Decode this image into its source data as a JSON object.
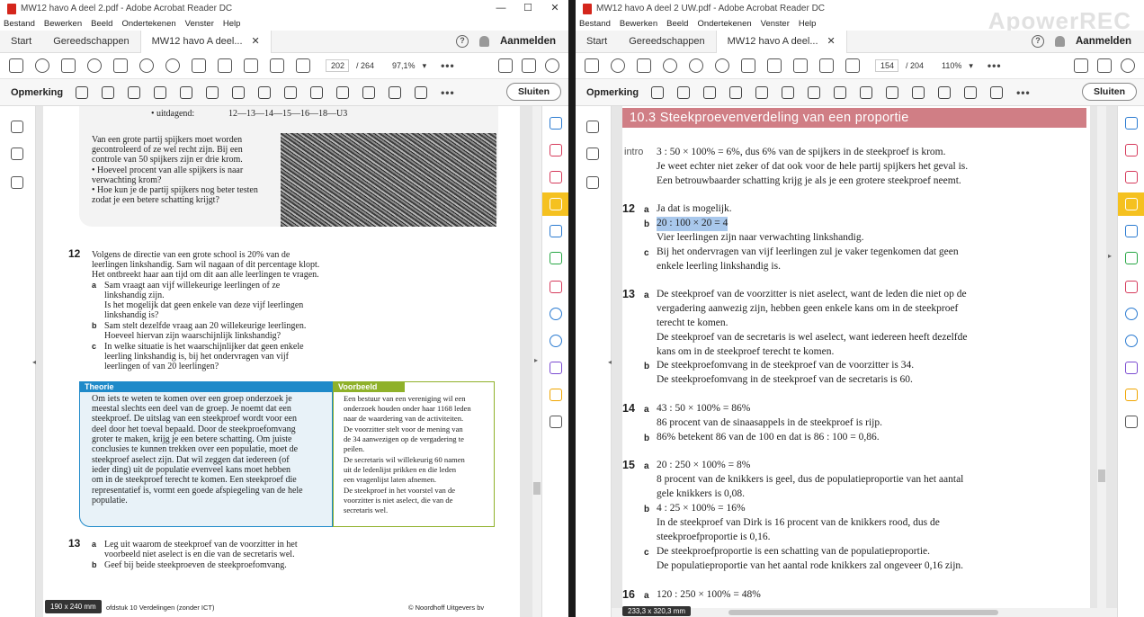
{
  "left": {
    "title": "MW12 havo A deel 2.pdf - Adobe Acrobat Reader DC",
    "menu": [
      "Bestand",
      "Bewerken",
      "Beeld",
      "Ondertekenen",
      "Venster",
      "Help"
    ],
    "tabs": {
      "start": "Start",
      "tools": "Gereedschappen",
      "doc": "MW12 havo A deel..."
    },
    "signin": "Aanmelden",
    "page_current": "202",
    "page_total": "/ 264",
    "zoom": "97,1%",
    "comment_label": "Opmerking",
    "close_label": "Sluiten",
    "size_badge": "190 x 240 mm",
    "content": {
      "uitdagend_label": "• uitdagend:",
      "uitdagend_values": "12—13—14—15—16—18—U3",
      "intro_lines": [
        "Van een grote partij spijkers moet worden",
        "gecontroleerd of ze wel recht zijn. Bij een",
        "controle van 50 spijkers zijn er drie krom.",
        "• Hoeveel procent van alle spijkers is naar",
        "   verwachting krom?",
        "• Hoe kun je de partij spijkers nog beter testen",
        "   zodat je een betere schatting krijgt?"
      ],
      "q12_num": "12",
      "q12_lines": [
        "Volgens de directie van een grote school is 20% van de",
        "leerlingen linkshandig. Sam wil nagaan of dit percentage klopt.",
        "Het ontbreekt haar aan tijd om dit aan alle leerlingen te vragen."
      ],
      "q12a_lines": [
        "Sam vraagt aan vijf willekeurige leerlingen of ze",
        "linkshandig zijn.",
        "Is het mogelijk dat geen enkele van deze vijf leerlingen",
        "linkshandig is?"
      ],
      "q12b_lines": [
        "Sam stelt dezelfde vraag aan 20 willekeurige leerlingen.",
        "Hoeveel hiervan zijn waarschijnlijk linkshandig?"
      ],
      "q12c_lines": [
        "In welke situatie is het waarschijnlijker dat geen enkele",
        "leerling linkshandig is, bij het ondervragen van vijf",
        "leerlingen of van 20 leerlingen?"
      ],
      "theory_head": "Theorie",
      "theory_lines": [
        "Om iets te weten te komen over een groep onderzoek je",
        "meestal slechts een deel van de groep. Je noemt dat een",
        "steekproef. De uitslag van een steekproef wordt voor een",
        "deel door het toeval bepaald. Door de steekproefomvang",
        "groter te maken, krijg je een betere schatting. Om juiste",
        "conclusies te kunnen trekken over een populatie, moet de",
        "steekproef aselect zijn. Dat wil zeggen dat iedereen (of",
        "ieder ding) uit de populatie evenveel kans moet hebben",
        "om in de steekproef terecht te komen. Een steekproef die",
        "representatief is, vormt een goede afspiegeling van de hele",
        "populatie."
      ],
      "example_head": "Voorbeeld",
      "example_lines": [
        "Een bestuur van een vereniging wil een",
        "onderzoek houden onder haar 1168 leden",
        "naar de waardering van de activiteiten.",
        "De voorzitter stelt voor de mening van",
        "de 34 aanwezigen op de vergadering te",
        "peilen.",
        "De secretaris wil willekeurig 60 namen",
        "uit de ledenlijst prikken en die leden",
        "een vragenlijst laten afnemen.",
        "De steekproef in het voorstel van de",
        "voorzitter is niet aselect, die van de",
        "secretaris wel."
      ],
      "q13_num": "13",
      "q13a": "Leg uit waarom de steekproef van de voorzitter in het",
      "q13a2": "voorbeeld niet aselect is en die van de secretaris wel.",
      "q13b": "Geef bij beide steekproeven de steekproefomvang.",
      "footer_left": "ofdstuk 10 Verdelingen (zonder ICT)",
      "footer_right": "© Noordhoff Uitgevers bv"
    }
  },
  "right": {
    "title": "MW12 havo A deel 2 UW.pdf - Adobe Acrobat Reader DC",
    "menu": [
      "Bestand",
      "Bewerken",
      "Beeld",
      "Ondertekenen",
      "Venster",
      "Help"
    ],
    "tabs": {
      "start": "Start",
      "tools": "Gereedschappen",
      "doc": "MW12 havo A deel..."
    },
    "signin": "Aanmelden",
    "page_current": "154",
    "page_total": "/ 204",
    "zoom": "110%",
    "comment_label": "Opmerking",
    "close_label": "Sluiten",
    "size_badge": "233,3 x 320,3 mm",
    "watermark": "ApowerREC",
    "content": {
      "heading": "10.3  Steekproevenverdeling van een proportie",
      "intro_label": "intro",
      "intro": [
        "3 : 50 × 100% = 6%, dus 6% van de spijkers in de steekproef is krom.",
        "Je weet echter niet zeker of dat ook voor de hele partij spijkers het geval is.",
        "Een betrouwbaarder schatting krijg je als je een grotere steekproef neemt."
      ],
      "a12a": "Ja dat is mogelijk.",
      "a12b_hl": "20 : 100 × 20 = 4",
      "a12b2": "Vier leerlingen zijn naar verwachting linkshandig.",
      "a12c": [
        "Bij het ondervragen van vijf leerlingen zul je vaker tegenkomen dat geen",
        "enkele leerling linkshandig is."
      ],
      "a13a": [
        "De steekproef van de voorzitter is niet aselect, want de leden die niet op de",
        "vergadering aanwezig zijn, hebben geen enkele kans om in de steekproef",
        "terecht te komen.",
        "De steekproef van de secretaris is wel aselect, want iedereen heeft dezelfde",
        "kans om in de steekproef terecht te komen."
      ],
      "a13b": [
        "De steekproefomvang in de steekproef van de voorzitter is 34.",
        "De steekproefomvang in de steekproef van de secretaris is 60."
      ],
      "a14a": [
        "43 : 50 × 100% = 86%",
        "86 procent van de sinaasappels in de steekproef is rijp."
      ],
      "a14b": "86% betekent 86 van de 100 en dat is 86 : 100 = 0,86.",
      "a15a": [
        "20 : 250 × 100% = 8%",
        "8 procent van de knikkers is geel, dus de populatieproportie van het aantal",
        "gele knikkers is 0,08."
      ],
      "a15b": [
        "4 : 25 × 100% = 16%",
        "In de steekproef van Dirk is 16 procent van de knikkers rood, dus de",
        "steekproefproportie is 0,16."
      ],
      "a15c": [
        "De steekproefproportie is een schatting van de populatieproportie.",
        "De populatieproportie van het aantal rode knikkers zal ongeveer 0,16 zijn."
      ],
      "a16a": "120 : 250 × 100% = 48%",
      "labels": {
        "n12": "12",
        "n13": "13",
        "n14": "14",
        "n15": "15",
        "n16": "16",
        "a": "a",
        "b": "b",
        "c": "c"
      }
    }
  }
}
